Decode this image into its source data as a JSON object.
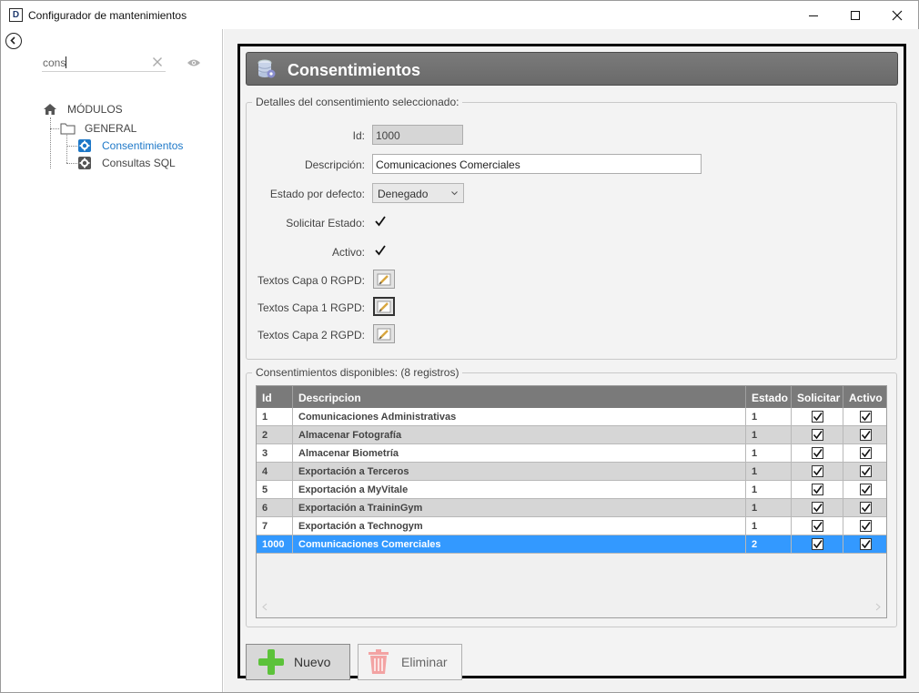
{
  "window": {
    "title": "Configurador de mantenimientos",
    "app_icon": "D"
  },
  "sidebar": {
    "search_value": "cons",
    "tree": {
      "root": "MÓDULOS",
      "group": "GENERAL",
      "items": [
        {
          "label": "Consentimientos",
          "selected": true
        },
        {
          "label": "Consultas SQL",
          "selected": false
        }
      ]
    }
  },
  "panel": {
    "title": "Consentimientos",
    "details": {
      "legend": "Detalles del consentimiento seleccionado:",
      "id_label": "Id:",
      "id_value": "1000",
      "desc_label": "Descripción:",
      "desc_value": "Comunicaciones Comerciales",
      "estado_label": "Estado por defecto:",
      "estado_value": "Denegado",
      "solicitar_label": "Solicitar Estado:",
      "activo_label": "Activo:",
      "capa0_label": "Textos Capa 0 RGPD:",
      "capa1_label": "Textos Capa 1 RGPD:",
      "capa2_label": "Textos Capa 2 RGPD:"
    },
    "list": {
      "legend": "Consentimientos disponibles:  (8 registros)",
      "columns": [
        "Id",
        "Descripcion",
        "Estado",
        "Solicitar",
        "Activo"
      ],
      "rows": [
        {
          "id": "1",
          "desc": "Comunicaciones Administrativas",
          "estado": "1",
          "solicitar": true,
          "activo": true
        },
        {
          "id": "2",
          "desc": "Almacenar Fotografía",
          "estado": "1",
          "solicitar": true,
          "activo": true
        },
        {
          "id": "3",
          "desc": "Almacenar Biometría",
          "estado": "1",
          "solicitar": true,
          "activo": true
        },
        {
          "id": "4",
          "desc": "Exportación a Terceros",
          "estado": "1",
          "solicitar": true,
          "activo": true
        },
        {
          "id": "5",
          "desc": "Exportación a MyVitale",
          "estado": "1",
          "solicitar": true,
          "activo": true
        },
        {
          "id": "6",
          "desc": "Exportación a TraininGym",
          "estado": "1",
          "solicitar": true,
          "activo": true
        },
        {
          "id": "7",
          "desc": "Exportación a Technogym",
          "estado": "1",
          "solicitar": true,
          "activo": true
        },
        {
          "id": "1000",
          "desc": "Comunicaciones Comerciales",
          "estado": "2",
          "solicitar": true,
          "activo": true
        }
      ],
      "selected_index": 7
    },
    "actions": {
      "new_label": "Nuevo",
      "delete_label": "Eliminar"
    }
  },
  "colors": {
    "accent": "#3399ff",
    "selected_tree": "#1e78c8",
    "header_bg": "#707070",
    "row_alt": "#d6d6d6"
  }
}
